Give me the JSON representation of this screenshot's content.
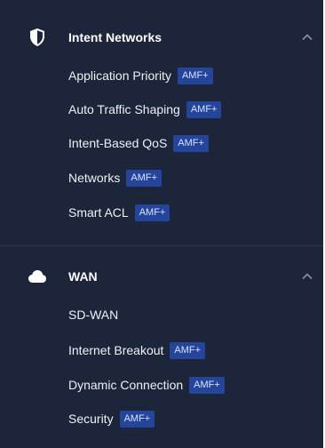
{
  "sections": [
    {
      "title": "Intent Networks",
      "icon": "shield-icon",
      "expanded": true,
      "items": [
        {
          "label": "Application Priority",
          "badge": "AMF+"
        },
        {
          "label": "Auto Traffic Shaping",
          "badge": "AMF+"
        },
        {
          "label": "Intent-Based QoS",
          "badge": "AMF+"
        },
        {
          "label": "Networks",
          "badge": "AMF+"
        },
        {
          "label": "Smart ACL",
          "badge": "AMF+"
        }
      ]
    },
    {
      "title": "WAN",
      "icon": "cloud-icon",
      "expanded": true,
      "items": [
        {
          "label": "SD-WAN",
          "badge": ""
        },
        {
          "label": "Internet Breakout",
          "badge": "AMF+"
        },
        {
          "label": "Dynamic Connection",
          "badge": "AMF+"
        },
        {
          "label": "Security",
          "badge": "AMF+"
        }
      ]
    }
  ],
  "colors": {
    "panel_background": "#1c2539",
    "badge_background": "#24459a",
    "text": "#ffffff"
  }
}
